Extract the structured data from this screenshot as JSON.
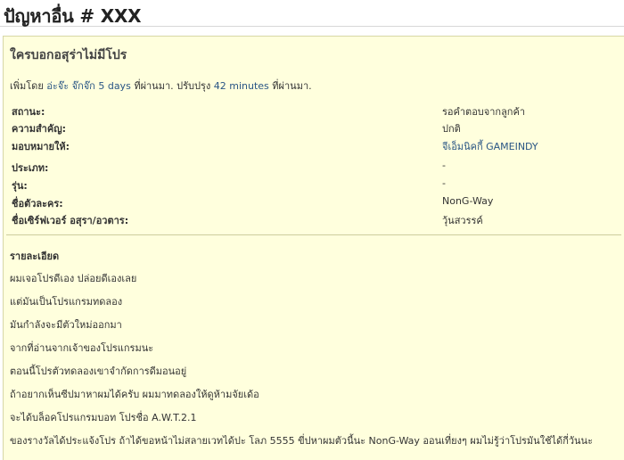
{
  "header": {
    "title_prefix": "ปัญหาอื่น #",
    "title_id": "XXX"
  },
  "issue": {
    "subject": "ใครบอกอสุร่าไม่มีโปร",
    "added_by_prefix": "เพิ่มโดย",
    "author": "อ่ะจ๊ะ จ๊กจ๊ก",
    "created_ago": "5 days",
    "created_suffix": "ที่ผ่านมา. ปรับปรุง",
    "updated_ago": "42 minutes",
    "updated_suffix": "ที่ผ่านมา."
  },
  "attributes": [
    {
      "label": "สถานะ:",
      "value": "รอคำตอบจากลูกค้า"
    },
    {
      "label": "ความสำคัญ:",
      "value": "ปกติ"
    },
    {
      "label": "มอบหมายให้:",
      "value": "จีเอ็มนิคกี้ GAMEINDY"
    },
    {
      "label": "ประเภท:",
      "value": "-"
    },
    {
      "label": "รุ่น:",
      "value": "-"
    },
    {
      "label": "ชื่อตัวละคร:",
      "value": "NonG-Way"
    },
    {
      "label": "ชื่อเซิร์ฟเวอร์ อสุรา/อวตาร:",
      "value": "วุ้นสวรรค์"
    }
  ],
  "description": {
    "title": "รายละเอียด",
    "lines": [
      "ผมเจอโปรดีเอง ปล่อยดีเองเลย",
      "แต่มันเป็นโปรแกรมทดลอง",
      "มันกำลังจะมีตัวใหม่ออกมา",
      "จากที่อ่านจากเจ้าของโปรแกรมนะ",
      "ตอนนี้โปรตัวทดลองเขาจำกัดการดีมอนอยู่",
      "ถ้าอยากเห็นซีปมาหาผมได้ครับ ผมมาทดลองให้ดูห้ามจัยเด้อ",
      "จะได้บล็อคโปรแกรมบอท โปรชื่อ A.W.T.2.1",
      "ของรางวัลได้ประแจ้งโปร ถ้าได้ขอหน้าไม่สลายเวทได้ปะ โลภ 5555 ขี่ปหาผมตัวนี้นะ NonG-Way ออนเที่ยงๆ ผมไม่รู้ว่าโปรมันใช้ได้กี่วันนะ"
    ]
  }
}
